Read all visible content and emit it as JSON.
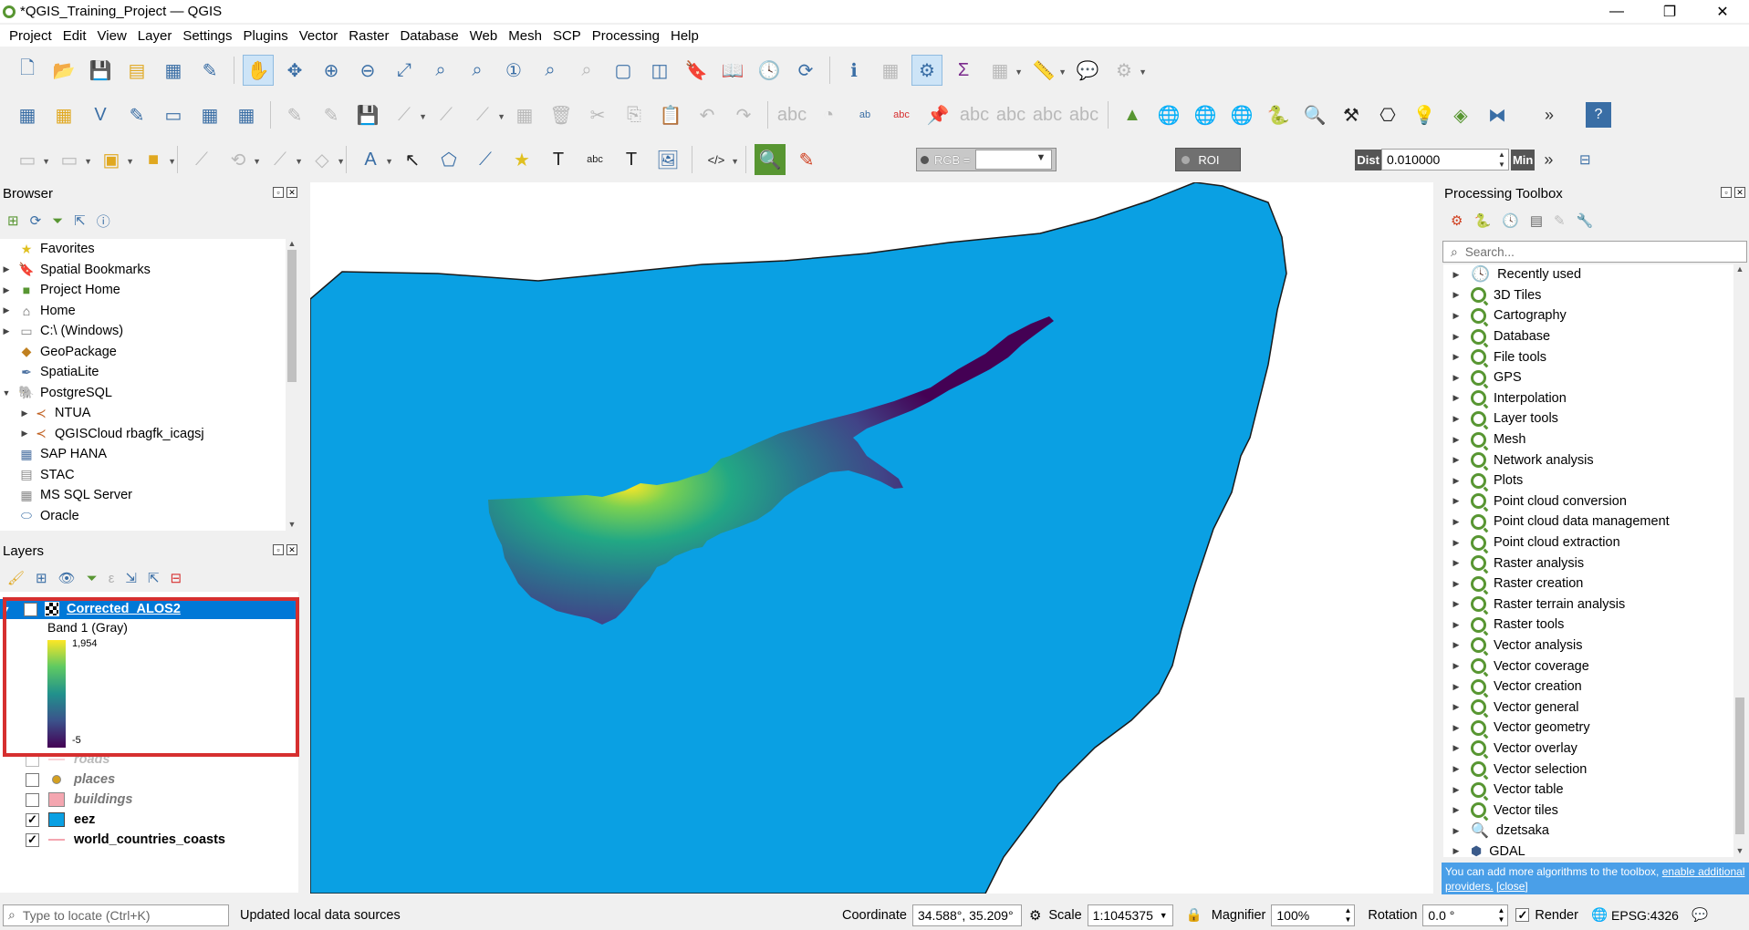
{
  "window": {
    "title": "*QGIS_Training_Project — QGIS",
    "minimize": "—",
    "restore": "❐",
    "close": "✕"
  },
  "menu": [
    "Project",
    "Edit",
    "View",
    "Layer",
    "Settings",
    "Plugins",
    "Vector",
    "Raster",
    "Database",
    "Web",
    "Mesh",
    "SCP",
    "Processing",
    "Help"
  ],
  "toolbar3": {
    "rgb_label": "RGB =",
    "roi_label": "ROI",
    "dist_label": "Dist",
    "dist_value": "0.010000",
    "min_label": "Min"
  },
  "browser": {
    "title": "Browser",
    "items": [
      {
        "label": "Favorites",
        "icon": "star-icon",
        "expand": ""
      },
      {
        "label": "Spatial Bookmarks",
        "icon": "bookmark-icon",
        "expand": "▶"
      },
      {
        "label": "Project Home",
        "icon": "project-home-icon",
        "expand": "▶"
      },
      {
        "label": "Home",
        "icon": "home-icon",
        "expand": "▶"
      },
      {
        "label": "C:\\ (Windows)",
        "icon": "drive-icon",
        "expand": "▶"
      },
      {
        "label": "GeoPackage",
        "icon": "geopackage-icon",
        "expand": ""
      },
      {
        "label": "SpatiaLite",
        "icon": "spatialite-icon",
        "expand": ""
      },
      {
        "label": "PostgreSQL",
        "icon": "postgresql-icon",
        "expand": "▼"
      },
      {
        "label": "NTUA",
        "icon": "connection-icon",
        "expand": "▶"
      },
      {
        "label": "QGISCloud rbagfk_icagsj",
        "icon": "connection-icon",
        "expand": "▶"
      },
      {
        "label": "SAP HANA",
        "icon": "sap-hana-icon",
        "expand": ""
      },
      {
        "label": "STAC",
        "icon": "stac-icon",
        "expand": ""
      },
      {
        "label": "MS SQL Server",
        "icon": "mssql-icon",
        "expand": ""
      },
      {
        "label": "Oracle",
        "icon": "oracle-icon",
        "expand": ""
      }
    ]
  },
  "layers": {
    "title": "Layers",
    "active": {
      "name": "Corrected_ALOS2",
      "band": "Band 1 (Gray)",
      "max": "1,954",
      "min": "-5"
    },
    "others": [
      {
        "name": "roads",
        "checked": "",
        "type": "line"
      },
      {
        "name": "places",
        "checked": "",
        "type": "point"
      },
      {
        "name": "buildings",
        "checked": "",
        "type": "polygon"
      },
      {
        "name": "eez",
        "checked": "✓",
        "type": "polygon"
      },
      {
        "name": "world_countries_coasts",
        "checked": "✓",
        "type": "line"
      }
    ]
  },
  "processing": {
    "title": "Processing Toolbox",
    "search_placeholder": "Search...",
    "items": [
      "Recently used",
      "3D Tiles",
      "Cartography",
      "Database",
      "File tools",
      "GPS",
      "Interpolation",
      "Layer tools",
      "Mesh",
      "Network analysis",
      "Plots",
      "Point cloud conversion",
      "Point cloud data management",
      "Point cloud extraction",
      "Raster analysis",
      "Raster creation",
      "Raster terrain analysis",
      "Raster tools",
      "Vector analysis",
      "Vector coverage",
      "Vector creation",
      "Vector general",
      "Vector geometry",
      "Vector overlay",
      "Vector selection",
      "Vector table",
      "Vector tiles",
      "dzetsaka",
      "GDAL"
    ],
    "info_text": "You can add more algorithms to the toolbox,",
    "info_link1": "enable additional providers.",
    "info_link2": "[close]"
  },
  "status": {
    "locate_placeholder": "Type to locate (Ctrl+K)",
    "message": "Updated local data sources",
    "coordinate_label": "Coordinate",
    "coordinate_value": "34.588°, 35.209°",
    "scale_label": "Scale",
    "scale_value": "1:1045375",
    "magnifier_label": "Magnifier",
    "magnifier_value": "100%",
    "rotation_label": "Rotation",
    "rotation_value": "0.0 °",
    "render_label": "Render",
    "crs": "EPSG:4326"
  },
  "colors": {
    "eez": "#0aa0e3",
    "highlight": "#d62f2f",
    "selection": "#0078d7",
    "buildings": "#f4a6b0"
  }
}
